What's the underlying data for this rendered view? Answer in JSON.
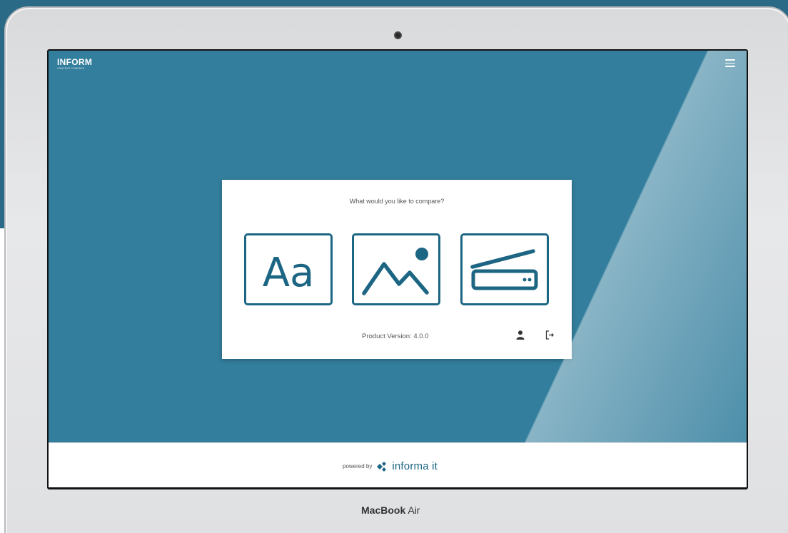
{
  "header": {
    "brand": "INFORM",
    "tagline": "CONTENT COMPARE",
    "menu_icon": "hamburger-menu-icon"
  },
  "dialog": {
    "question": "What would you like to compare?",
    "options": [
      {
        "icon": "text-compare-icon",
        "glyph": "Aa"
      },
      {
        "icon": "image-compare-icon"
      },
      {
        "icon": "scanner-compare-icon"
      }
    ],
    "version": "Product Version: 4.0.0",
    "user_icon": "user-icon",
    "logout_icon": "logout-icon"
  },
  "footer": {
    "powered_by": "powered by",
    "vendor": "informa it"
  },
  "device": {
    "brand": "MacBook",
    "model": "Air"
  },
  "colors": {
    "screen_bg": "#337e9d",
    "accent": "#1d6683",
    "backdrop": "#2a6a86"
  }
}
